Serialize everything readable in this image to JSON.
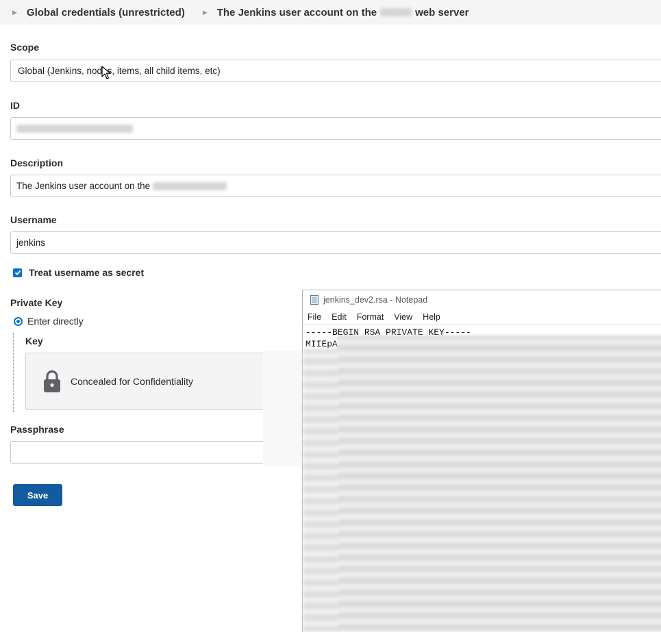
{
  "breadcrumb": {
    "items": [
      {
        "label": "Global credentials (unrestricted)"
      },
      {
        "label_prefix": "The Jenkins user account on the",
        "label_suffix": "web server"
      }
    ]
  },
  "form": {
    "scope": {
      "label": "Scope",
      "value": "Global (Jenkins, nodes, items, all child items, etc)"
    },
    "id": {
      "label": "ID"
    },
    "description": {
      "label": "Description",
      "value_prefix": "The Jenkins user account on the"
    },
    "username": {
      "label": "Username",
      "value": "jenkins"
    },
    "treat_username_secret": {
      "label": "Treat username as secret",
      "checked": true
    },
    "private_key": {
      "label": "Private Key",
      "option_label": "Enter directly",
      "key_label": "Key",
      "concealed_text": "Concealed for Confidentiality"
    },
    "passphrase": {
      "label": "Passphrase",
      "value": ""
    },
    "save_label": "Save"
  },
  "notepad": {
    "title": "jenkins_dev2.rsa - Notepad",
    "menu": [
      "File",
      "Edit",
      "Format",
      "View",
      "Help"
    ],
    "line1": "-----BEGIN RSA PRIVATE KEY-----",
    "line2": "MIIEpA"
  },
  "colors": {
    "primary_button": "#135b9f",
    "checkbox": "#0a72ce",
    "breadcrumb_bg": "#f5f5f6"
  },
  "icons": [
    "chevron-right-icon",
    "mouse-cursor-icon",
    "lock-icon",
    "notepad-file-icon"
  ]
}
